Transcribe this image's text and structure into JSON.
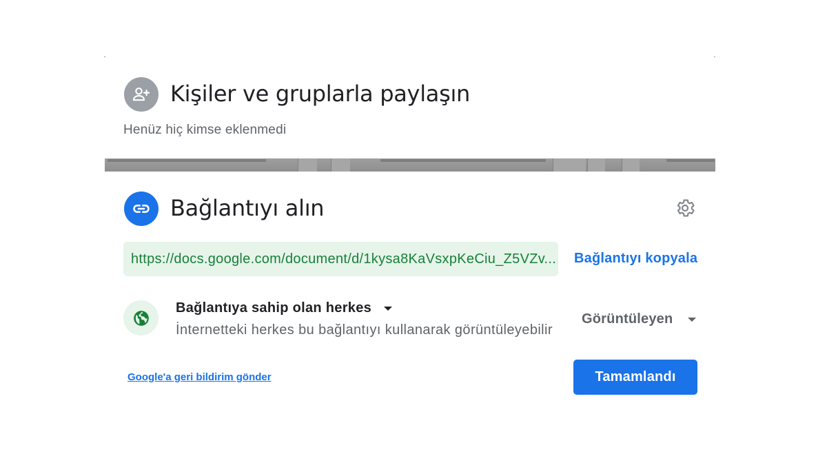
{
  "people": {
    "title": "Kişiler ve gruplarla paylaşın",
    "empty_text": "Henüz hiç kimse eklenmedi",
    "icon": "person-add-icon"
  },
  "link": {
    "title": "Bağlantıyı alın",
    "icon": "link-icon",
    "settings_icon": "gear-icon",
    "url": "https://docs.google.com/document/d/1kysa8KaVsxpKeCiu_Z5VZv...",
    "copy_label": "Bağlantıyı kopyala",
    "access": {
      "label": "Bağlantıya sahip olan herkes",
      "description": "İnternetteki herkes bu bağlantıyı kullanarak görüntüleyebilir",
      "icon": "globe-icon"
    },
    "role": "Görüntüleyen"
  },
  "footer": {
    "feedback_label": "Google'a geri bildirim gönder",
    "done_label": "Tamamlandı"
  },
  "colors": {
    "accent": "#1a73e8",
    "url_green": "#188038",
    "url_bg": "#e6f4ea",
    "avatar_grey": "#9aa0a6"
  }
}
